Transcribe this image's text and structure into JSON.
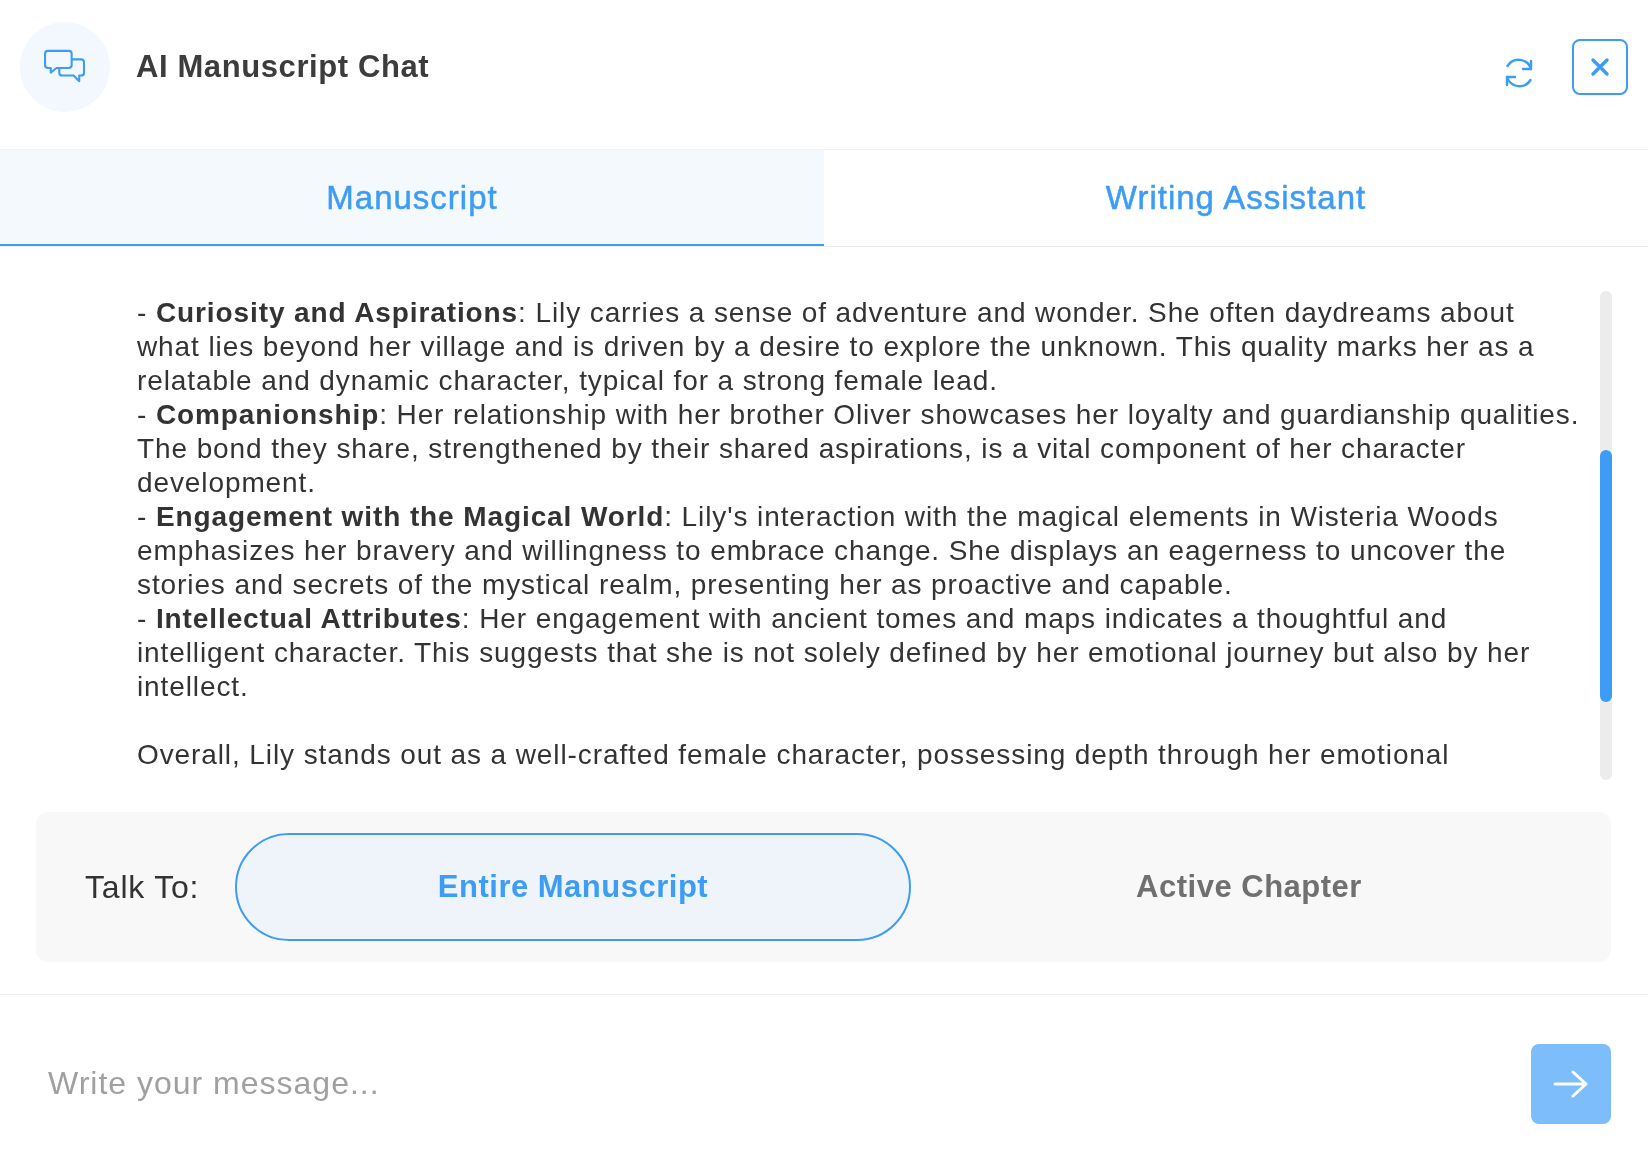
{
  "header": {
    "title": "AI Manuscript Chat"
  },
  "tabs": [
    {
      "label": "Manuscript",
      "selected": true
    },
    {
      "label": "Writing Assistant",
      "selected": false
    }
  ],
  "content": {
    "blocks": [
      {
        "kind": "bullet",
        "text": "- **Curiosity and Aspirations**: Lily carries a sense of adventure and wonder. She often daydreams about what lies beyond her village and is driven by a desire to explore the unknown. This quality marks her as a relatable and dynamic character, typical for a strong female lead."
      },
      {
        "kind": "bullet",
        "text": "- **Companionship**: Her relationship with her brother Oliver showcases her loyalty and guardianship qualities. The bond they share, strengthened by their shared aspirations, is a vital component of her character development."
      },
      {
        "kind": "bullet",
        "text": "- **Engagement with the Magical World**: Lily's interaction with the magical elements in Wisteria Woods emphasizes her bravery and willingness to embrace change. She displays an eagerness to uncover the stories and secrets of the mystical realm, presenting her as proactive and capable."
      },
      {
        "kind": "bullet",
        "text": "- **Intellectual Attributes**: Her engagement with ancient tomes and maps indicates a thoughtful and intelligent character. This suggests that she is not solely defined by her emotional journey but also by her intellect."
      },
      {
        "kind": "paragraph",
        "text": "Overall, Lily stands out as a well-crafted female character, possessing depth through her emotional"
      }
    ]
  },
  "talk_to": {
    "label": "Talk To:",
    "options": [
      {
        "label": "Entire Manuscript",
        "selected": true
      },
      {
        "label": "Active Chapter",
        "selected": false
      }
    ]
  },
  "composer": {
    "placeholder": "Write your message..."
  }
}
